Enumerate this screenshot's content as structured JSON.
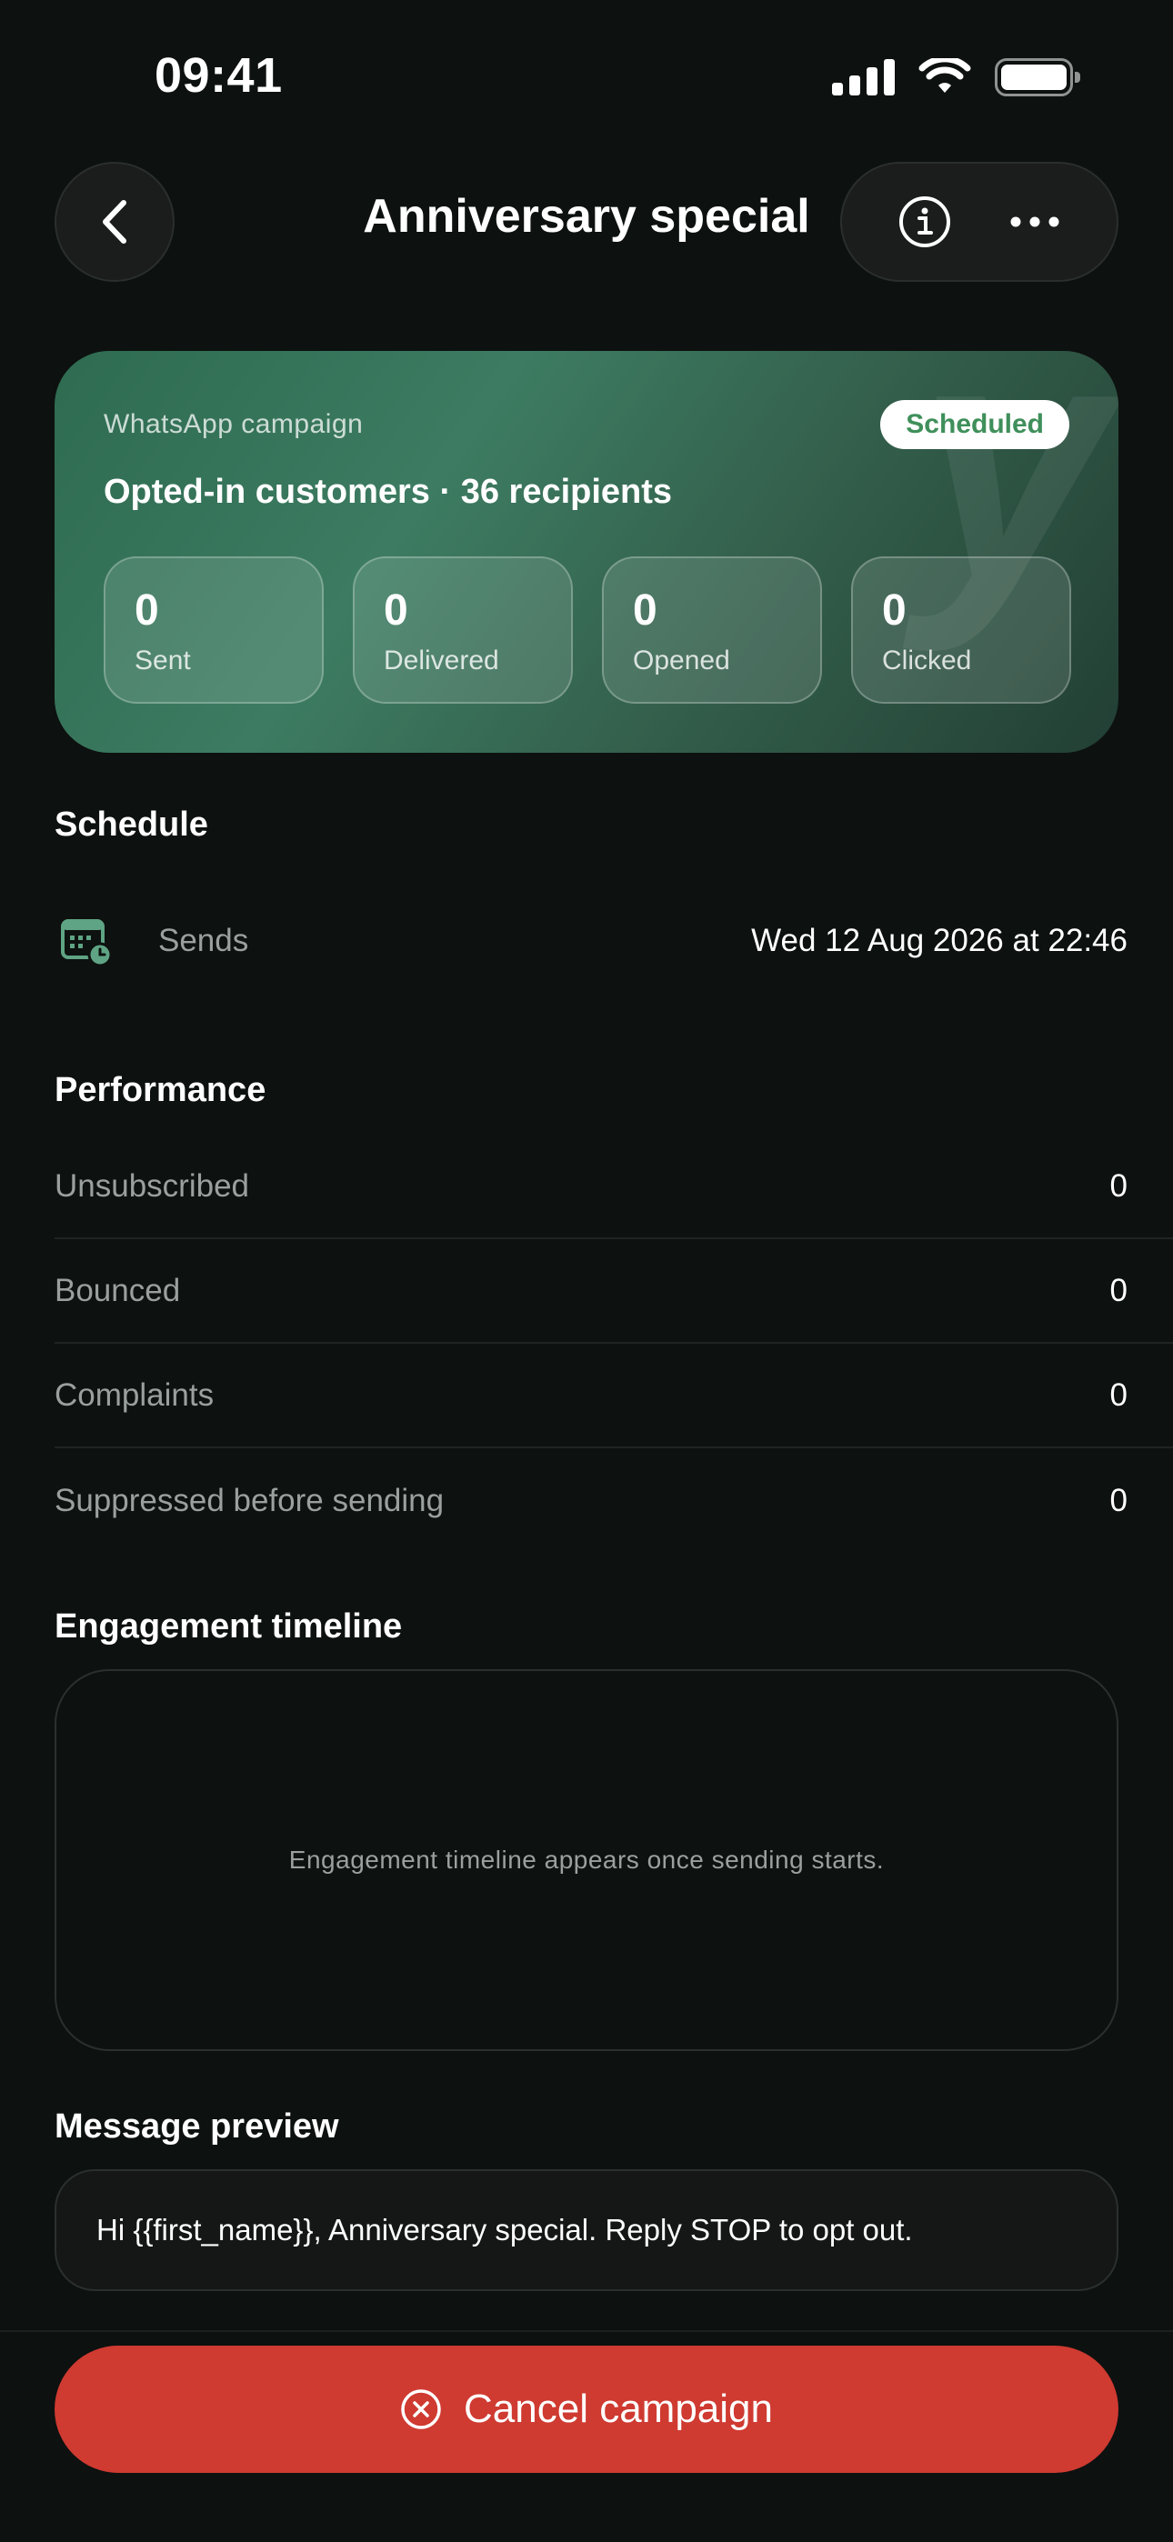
{
  "status_bar": {
    "time": "09:41"
  },
  "header": {
    "title": "Anniversary special"
  },
  "hero": {
    "kicker": "WhatsApp campaign",
    "badge": "Scheduled",
    "audience": "Opted-in customers · 36 recipients",
    "watermark": "y",
    "stats": [
      {
        "value": "0",
        "label": "Sent"
      },
      {
        "value": "0",
        "label": "Delivered"
      },
      {
        "value": "0",
        "label": "Opened"
      },
      {
        "value": "0",
        "label": "Clicked"
      }
    ]
  },
  "schedule": {
    "title": "Schedule",
    "label": "Sends",
    "value": "Wed 12 Aug 2026 at 22:46"
  },
  "performance": {
    "title": "Performance",
    "rows": [
      {
        "label": "Unsubscribed",
        "value": "0"
      },
      {
        "label": "Bounced",
        "value": "0"
      },
      {
        "label": "Complaints",
        "value": "0"
      },
      {
        "label": "Suppressed before sending",
        "value": "0"
      }
    ]
  },
  "timeline": {
    "title": "Engagement timeline",
    "empty_text": "Engagement timeline appears once sending starts."
  },
  "preview": {
    "title": "Message preview",
    "text": "Hi {{first_name}}, Anniversary special. Reply STOP to opt out."
  },
  "footer": {
    "cancel_label": "Cancel campaign"
  },
  "colors": {
    "background": "#0d1110",
    "hero_green": "#3d7c62",
    "badge_text": "#3f8f5a",
    "danger": "#cf3a31",
    "muted_text": "#9aa09e"
  },
  "icons": [
    "back-chevron-icon",
    "info-icon",
    "more-icon",
    "calendar-clock-icon",
    "close-circle-icon",
    "signal-icon",
    "wifi-icon",
    "battery-icon"
  ]
}
